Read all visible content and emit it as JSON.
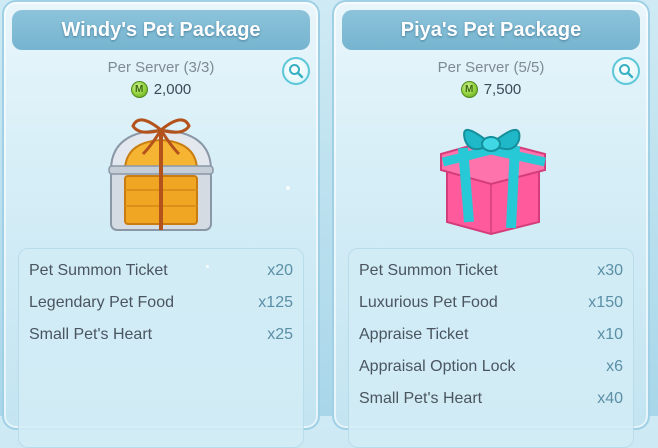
{
  "packages": [
    {
      "title": "Windy's Pet Package",
      "limit": "Per Server (3/3)",
      "price": "2,000",
      "icon": "treasure-chest-icon",
      "items": [
        {
          "name": "Pet Summon Ticket",
          "qty": "x20"
        },
        {
          "name": "Legendary Pet Food",
          "qty": "x125"
        },
        {
          "name": "Small Pet's Heart",
          "qty": "x25"
        }
      ]
    },
    {
      "title": "Piya's Pet Package",
      "limit": "Per Server (5/5)",
      "price": "7,500",
      "icon": "gift-box-icon",
      "items": [
        {
          "name": "Pet Summon Ticket",
          "qty": "x30"
        },
        {
          "name": "Luxurious Pet Food",
          "qty": "x150"
        },
        {
          "name": "Appraise Ticket",
          "qty": "x10"
        },
        {
          "name": "Appraisal Option Lock",
          "qty": "x6"
        },
        {
          "name": "Small Pet's Heart",
          "qty": "x40"
        }
      ]
    }
  ],
  "colors": {
    "header": "#7fbad3",
    "accent": "#5cc7d8",
    "coin": "#8fcf3a"
  }
}
